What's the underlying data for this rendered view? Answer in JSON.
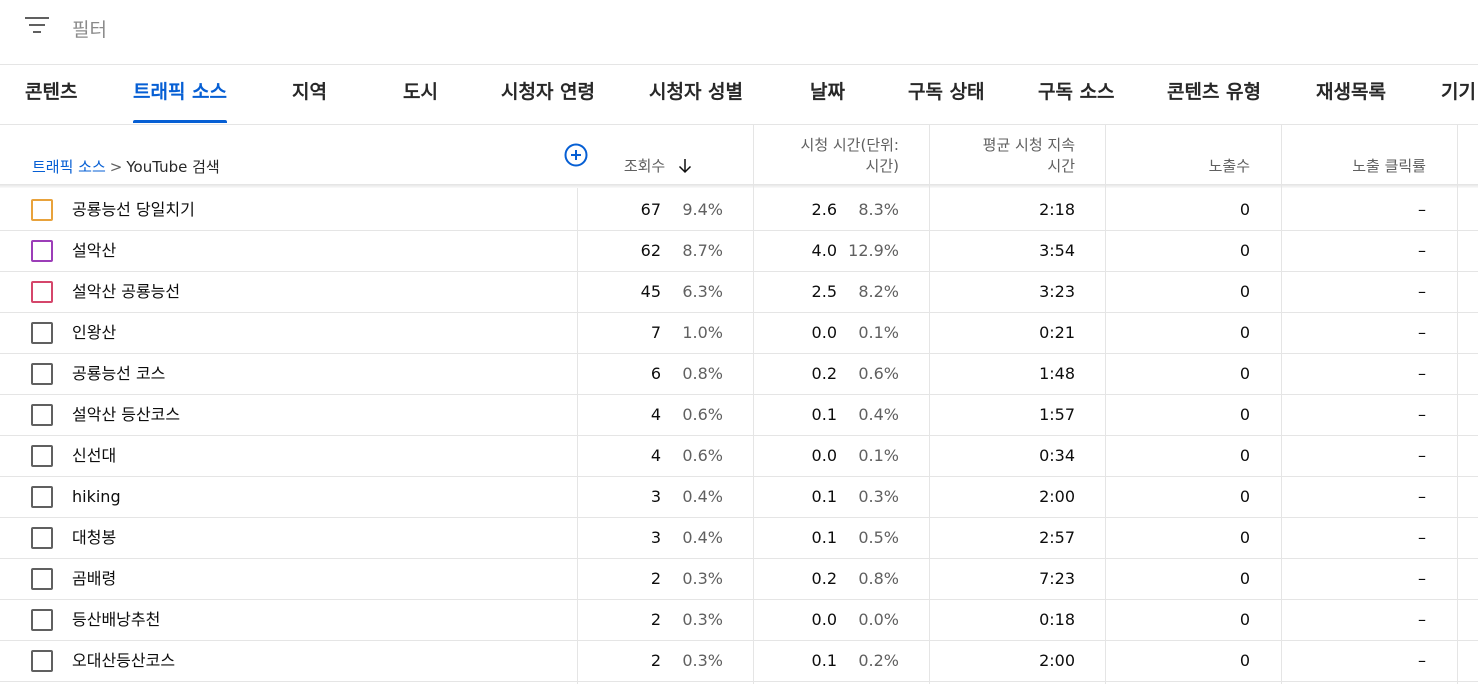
{
  "filter": {
    "label": "필터"
  },
  "tabs": [
    {
      "label": "콘텐츠"
    },
    {
      "label": "트래픽 소스"
    },
    {
      "label": "지역"
    },
    {
      "label": "도시"
    },
    {
      "label": "시청자 연령"
    },
    {
      "label": "시청자 성별"
    },
    {
      "label": "날짜"
    },
    {
      "label": "구독 상태"
    },
    {
      "label": "구독 소스"
    },
    {
      "label": "콘텐츠 유형"
    },
    {
      "label": "재생목록"
    },
    {
      "label": "기기"
    }
  ],
  "active_tab": "트래픽 소스",
  "breadcrumb": {
    "parent": "트래픽 소스",
    "separator": ">",
    "current": "YouTube 검색"
  },
  "columns": {
    "views": "조회수",
    "watch_time": "시청 시간(단위: 시간)",
    "watch_time_line1": "시청 시간(단위:",
    "watch_time_line2": "시간)",
    "avg_duration_line1": "평균 시청 지속",
    "avg_duration_line2": "시간",
    "impressions": "노출수",
    "ctr": "노출 클릭률"
  },
  "sort_icon": "arrow-down-icon",
  "accent_color": "#065fd4",
  "rows": [
    {
      "term": "공룡능선 당일치기",
      "views": "67",
      "views_pct": "9.4%",
      "watch": "2.6",
      "watch_pct": "8.3%",
      "avg": "2:18",
      "impr": "0",
      "ctr": "–",
      "color": "#e8a23b"
    },
    {
      "term": "설악산",
      "views": "62",
      "views_pct": "8.7%",
      "watch": "4.0",
      "watch_pct": "12.9%",
      "avg": "3:54",
      "impr": "0",
      "ctr": "–",
      "color": "#9c3db8"
    },
    {
      "term": "설악산 공룡능선",
      "views": "45",
      "views_pct": "6.3%",
      "watch": "2.5",
      "watch_pct": "8.2%",
      "avg": "3:23",
      "impr": "0",
      "ctr": "–",
      "color": "#d5466b"
    },
    {
      "term": "인왕산",
      "views": "7",
      "views_pct": "1.0%",
      "watch": "0.0",
      "watch_pct": "0.1%",
      "avg": "0:21",
      "impr": "0",
      "ctr": "–",
      "color": "#606060"
    },
    {
      "term": "공룡능선 코스",
      "views": "6",
      "views_pct": "0.8%",
      "watch": "0.2",
      "watch_pct": "0.6%",
      "avg": "1:48",
      "impr": "0",
      "ctr": "–",
      "color": "#606060"
    },
    {
      "term": "설악산 등산코스",
      "views": "4",
      "views_pct": "0.6%",
      "watch": "0.1",
      "watch_pct": "0.4%",
      "avg": "1:57",
      "impr": "0",
      "ctr": "–",
      "color": "#606060"
    },
    {
      "term": "신선대",
      "views": "4",
      "views_pct": "0.6%",
      "watch": "0.0",
      "watch_pct": "0.1%",
      "avg": "0:34",
      "impr": "0",
      "ctr": "–",
      "color": "#606060"
    },
    {
      "term": "hiking",
      "views": "3",
      "views_pct": "0.4%",
      "watch": "0.1",
      "watch_pct": "0.3%",
      "avg": "2:00",
      "impr": "0",
      "ctr": "–",
      "color": "#606060"
    },
    {
      "term": "대청봉",
      "views": "3",
      "views_pct": "0.4%",
      "watch": "0.1",
      "watch_pct": "0.5%",
      "avg": "2:57",
      "impr": "0",
      "ctr": "–",
      "color": "#606060"
    },
    {
      "term": "곰배령",
      "views": "2",
      "views_pct": "0.3%",
      "watch": "0.2",
      "watch_pct": "0.8%",
      "avg": "7:23",
      "impr": "0",
      "ctr": "–",
      "color": "#606060"
    },
    {
      "term": "등산배낭추천",
      "views": "2",
      "views_pct": "0.3%",
      "watch": "0.0",
      "watch_pct": "0.0%",
      "avg": "0:18",
      "impr": "0",
      "ctr": "–",
      "color": "#606060"
    },
    {
      "term": "오대산등산코스",
      "views": "2",
      "views_pct": "0.3%",
      "watch": "0.1",
      "watch_pct": "0.2%",
      "avg": "2:00",
      "impr": "0",
      "ctr": "–",
      "color": "#606060"
    }
  ]
}
